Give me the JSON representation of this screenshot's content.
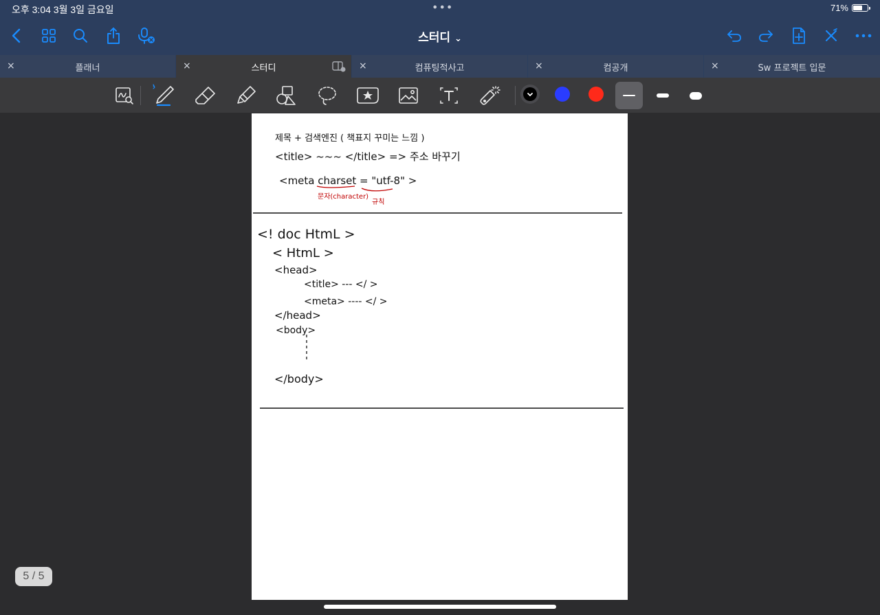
{
  "status": {
    "time": "오후 3:04   3월 3일 금요일",
    "dots": "•••",
    "battery": "71%",
    "battery_level": 0.71
  },
  "nav": {
    "title": "스터디",
    "title_chevron": "⌄",
    "left_icons": [
      "back-chevron-icon",
      "grid-icon",
      "search-icon",
      "share-icon",
      "microphone-icon"
    ],
    "right_icons": [
      "undo-icon",
      "redo-icon",
      "add-page-icon",
      "close-x-icon",
      "more-icon"
    ],
    "accent": "#1a8cff"
  },
  "tabs": [
    {
      "label": "플래너",
      "close": "×",
      "active": false
    },
    {
      "label": "스터디",
      "close": "×",
      "active": true
    },
    {
      "label": "컴퓨팅적사고",
      "close": "×",
      "active": false
    },
    {
      "label": "컴공개",
      "close": "×",
      "active": false
    },
    {
      "label": "Sw 프로젝트 입문",
      "close": "×",
      "active": false
    }
  ],
  "toolbar": {
    "tools": [
      "zoom-box-icon",
      "pen-icon",
      "eraser-icon",
      "highlighter-icon",
      "shapes-icon",
      "lasso-icon",
      "sticker-icon",
      "image-icon",
      "text-icon",
      "laser-pointer-icon"
    ],
    "colors": [
      "#000000",
      "#2a3cff",
      "#ff2a1a"
    ],
    "selected_color": "#000000",
    "stroke_sizes": [
      "thin",
      "medium",
      "thick"
    ],
    "selected_stroke": "thin"
  },
  "note": {
    "section1": {
      "line1": "제목 + 검색엔진 ( 책표지 꾸미는 느낌 )",
      "line2": "<title>  ~~~  </title>  => 주소 바꾸기",
      "line3": "<meta  charset = \"utf-8\" >",
      "red_note1": "문자(character)",
      "red_note2": "규칙"
    },
    "section2": {
      "doctype": "<! doc HtmL >",
      "html_open": "< HtmL >",
      "head_open": "<head>",
      "title_line": "<title>  ---  </ >",
      "meta_line": "<meta>  ----  </ >",
      "head_close": "</head>",
      "body_open": "<body>",
      "body_close": "</body>"
    }
  },
  "page_indicator": "5 / 5"
}
